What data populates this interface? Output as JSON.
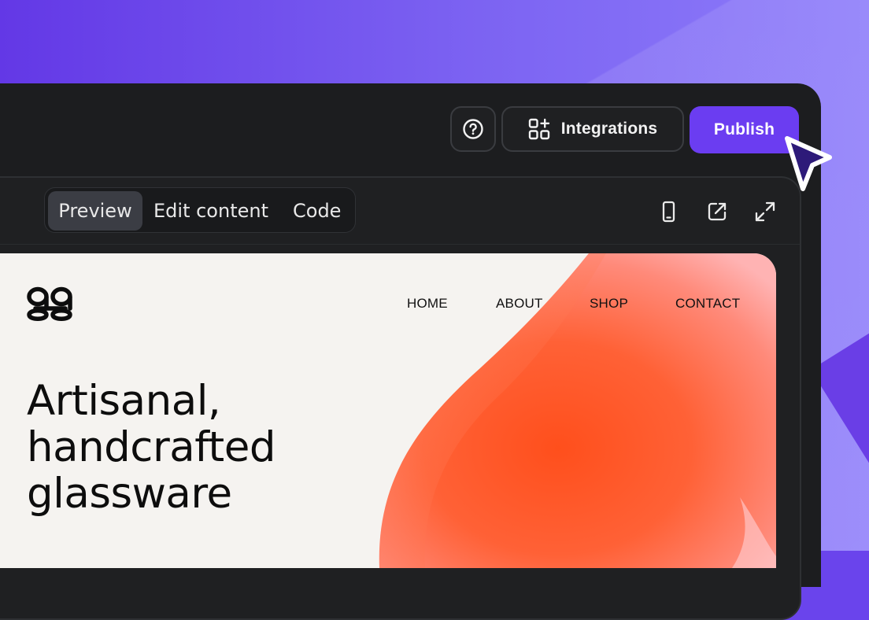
{
  "toolbar": {
    "help_icon": "question-circle-icon",
    "integrations_label": "Integrations",
    "integrations_icon": "apps-add-icon",
    "publish_label": "Publish"
  },
  "editor": {
    "tabs": [
      {
        "label": "Preview",
        "active": true
      },
      {
        "label": "Edit content",
        "active": false
      },
      {
        "label": "Code",
        "active": false
      }
    ],
    "tools": [
      "mobile-icon",
      "external-link-icon",
      "expand-icon"
    ]
  },
  "site": {
    "logo": "gg",
    "nav": [
      "HOME",
      "ABOUT",
      "SHOP",
      "CONTACT"
    ],
    "hero_title": "Artisanal,\nhandcrafted\nglassware"
  },
  "colors": {
    "accent": "#6b3df1",
    "window_bg": "#1c1d1f",
    "site_bg": "#f5f3f0",
    "blob": "#ff5722"
  }
}
